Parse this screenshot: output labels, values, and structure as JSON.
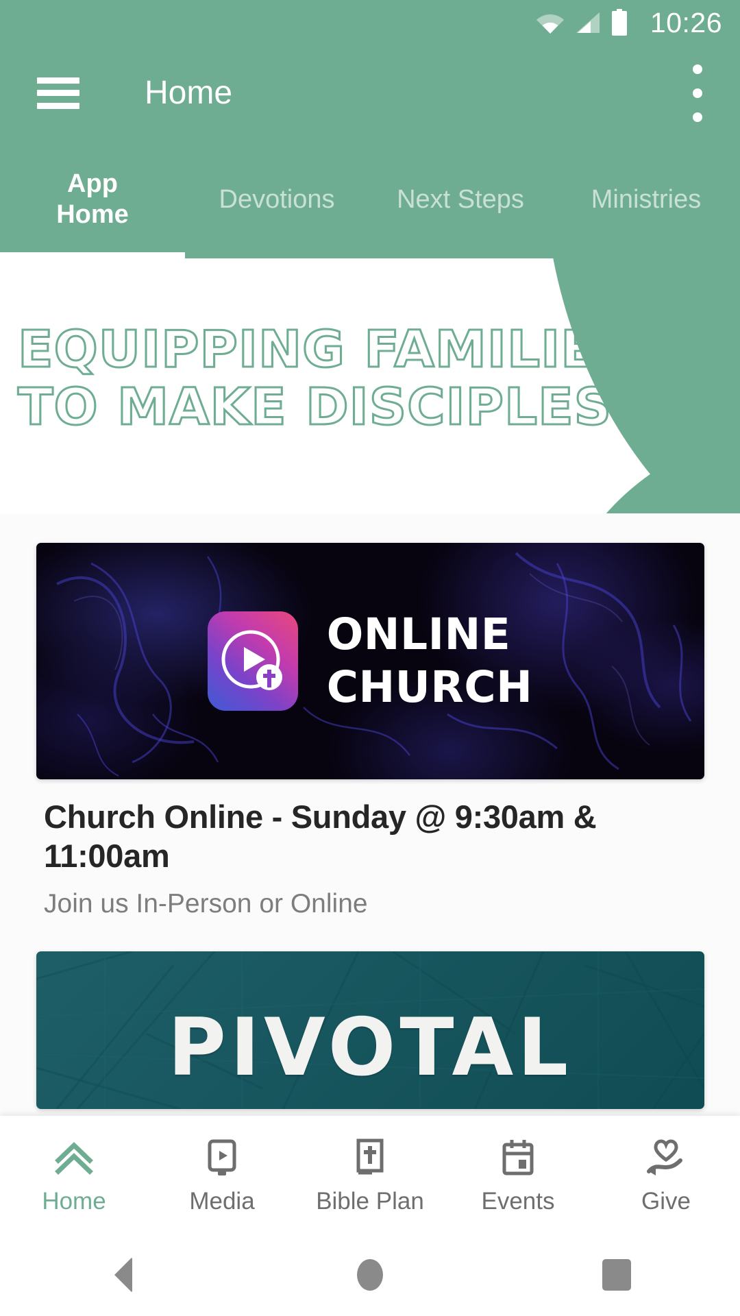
{
  "status_bar": {
    "time": "10:26",
    "icons": [
      "wifi-icon",
      "cellular-signal-icon",
      "battery-full-icon"
    ]
  },
  "app_bar": {
    "menu_icon": "hamburger-menu-icon",
    "title": "Home",
    "overflow_icon": "more-vertical-icon"
  },
  "tabs": [
    {
      "label": "App\nHome",
      "active": true
    },
    {
      "label": "Devotions",
      "active": false
    },
    {
      "label": "Next Steps",
      "active": false
    },
    {
      "label": "Ministries",
      "active": false
    }
  ],
  "hero": {
    "headline": "EQUIPPING FAMILIES\nTO MAKE DISCIPLES"
  },
  "cards": [
    {
      "id": "church-online",
      "image_title": "ONLINE\nCHURCH",
      "logo_icon": "play-cross-app-icon",
      "title": "Church Online - Sunday @ 9:30am & 11:00am",
      "subtitle": "Join us In-Person or Online"
    },
    {
      "id": "pivotal",
      "image_title": "PIVOTAL"
    }
  ],
  "bottom_nav": [
    {
      "label": "Home",
      "icon": "double-chevron-up-icon",
      "active": true
    },
    {
      "label": "Media",
      "icon": "tablet-play-icon",
      "active": false
    },
    {
      "label": "Bible Plan",
      "icon": "bible-book-icon",
      "active": false
    },
    {
      "label": "Events",
      "icon": "calendar-icon",
      "active": false
    },
    {
      "label": "Give",
      "icon": "hand-heart-icon",
      "active": false
    }
  ],
  "android_nav": [
    {
      "label": "Back",
      "icon": "back-triangle-icon"
    },
    {
      "label": "Home",
      "icon": "home-circle-icon"
    },
    {
      "label": "Recents",
      "icon": "recents-square-icon"
    }
  ],
  "colors": {
    "brand_green": "#6FAD93",
    "teal_card": "#12565F",
    "dark_card": "#07030F",
    "text_primary": "#262626",
    "text_secondary": "#7D7D7D",
    "nav_inactive": "#6E6E6E"
  }
}
